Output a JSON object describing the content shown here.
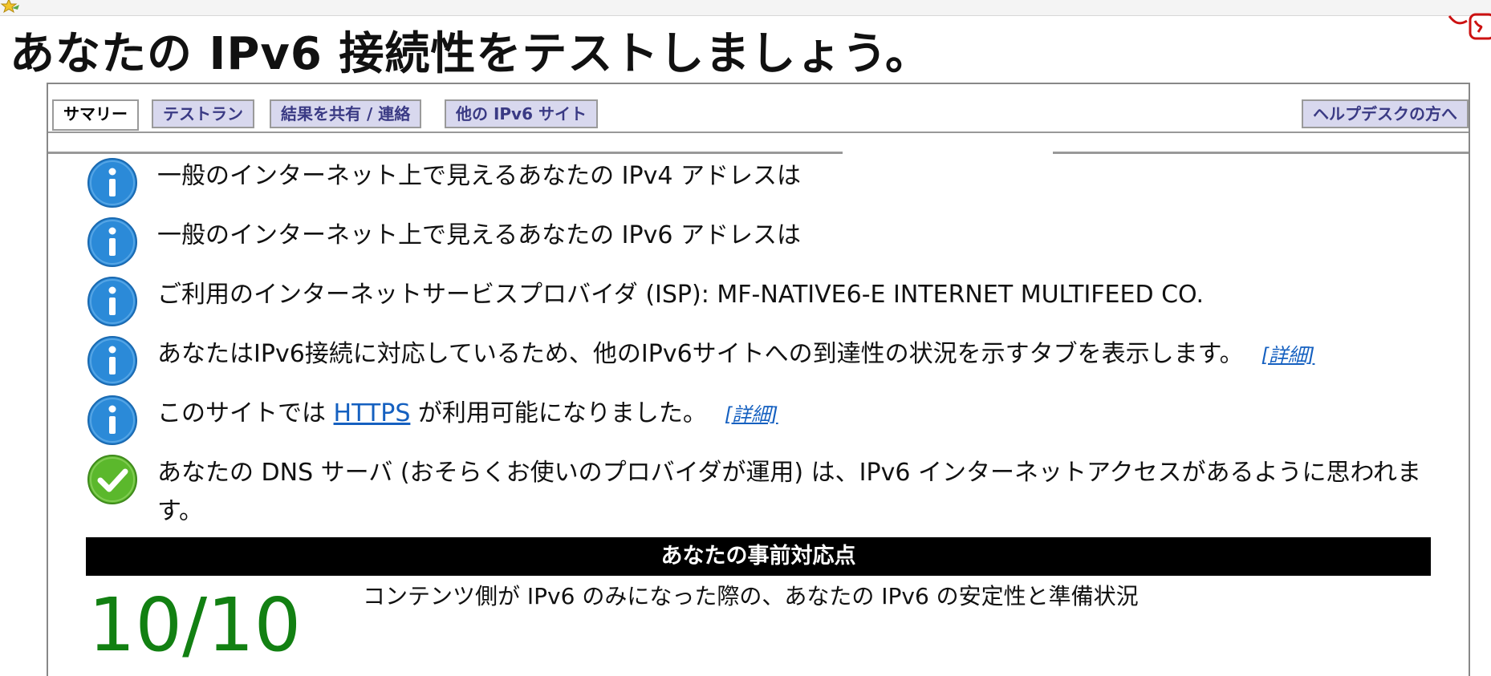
{
  "page_title": "あなたの IPv6 接続性をテストしましょう。",
  "tabs": [
    {
      "label": "サマリー",
      "active": true
    },
    {
      "label": "テストラン",
      "active": false
    },
    {
      "label": "結果を共有 / 連絡",
      "active": false
    },
    {
      "label": "他の IPv6 サイト",
      "active": false
    }
  ],
  "helpdesk_tab": {
    "label": "ヘルプデスクの方へ"
  },
  "info_rows": [
    {
      "icon": "info-icon",
      "text": "一般のインターネット上で見えるあなたの IPv4 アドレスは"
    },
    {
      "icon": "info-icon",
      "text": "一般のインターネット上で見えるあなたの IPv6 アドレスは"
    },
    {
      "icon": "info-icon",
      "text": "ご利用のインターネットサービスプロバイダ (ISP): MF-NATIVE6-E INTERNET MULTIFEED CO."
    },
    {
      "icon": "info-icon",
      "text": "あなたはIPv6接続に対応しているため、他のIPv6サイトへの到達性の状況を示すタブを表示します。",
      "detail": "[詳細]"
    },
    {
      "icon": "info-icon",
      "text_before": "このサイトでは",
      "link": "HTTPS",
      "text_after": "が利用可能になりました。",
      "detail": "[詳細]"
    },
    {
      "icon": "check-icon",
      "text": "あなたの DNS サーバ (おそらくお使いのプロバイダが運用) は、IPv6 インターネットアクセスがあるように思われます。"
    }
  ],
  "score": {
    "header": "あなたの事前対応点",
    "value": "10/10",
    "description": "コンテンツ側が IPv6 のみになった際の、あなたの IPv6 の安定性と準備状況"
  },
  "colors": {
    "tab_bg": "#d8d8ee",
    "tab_text": "#3a3a84",
    "link": "#1560c0",
    "score": "#128012",
    "info_icon": "#2b8ad8",
    "check_icon": "#5bb82c"
  }
}
